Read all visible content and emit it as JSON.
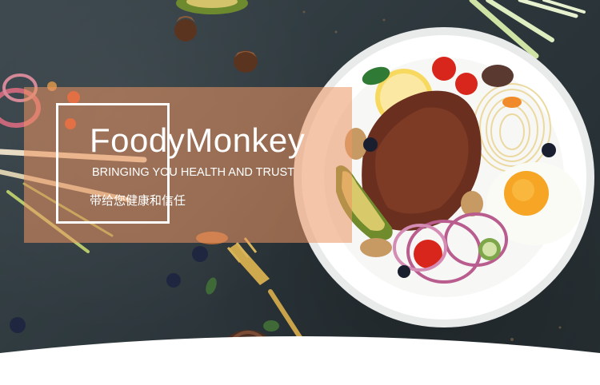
{
  "brand": {
    "name": "FoodyMonkey",
    "tagline_en": "BRINGING YOU HEALTH AND TRUST",
    "tagline_cn": "带给您健康和信任"
  },
  "colors": {
    "background": "#2f3a40",
    "panel": "#ec9662",
    "text": "#ffffff",
    "plate": "#ffffff"
  }
}
